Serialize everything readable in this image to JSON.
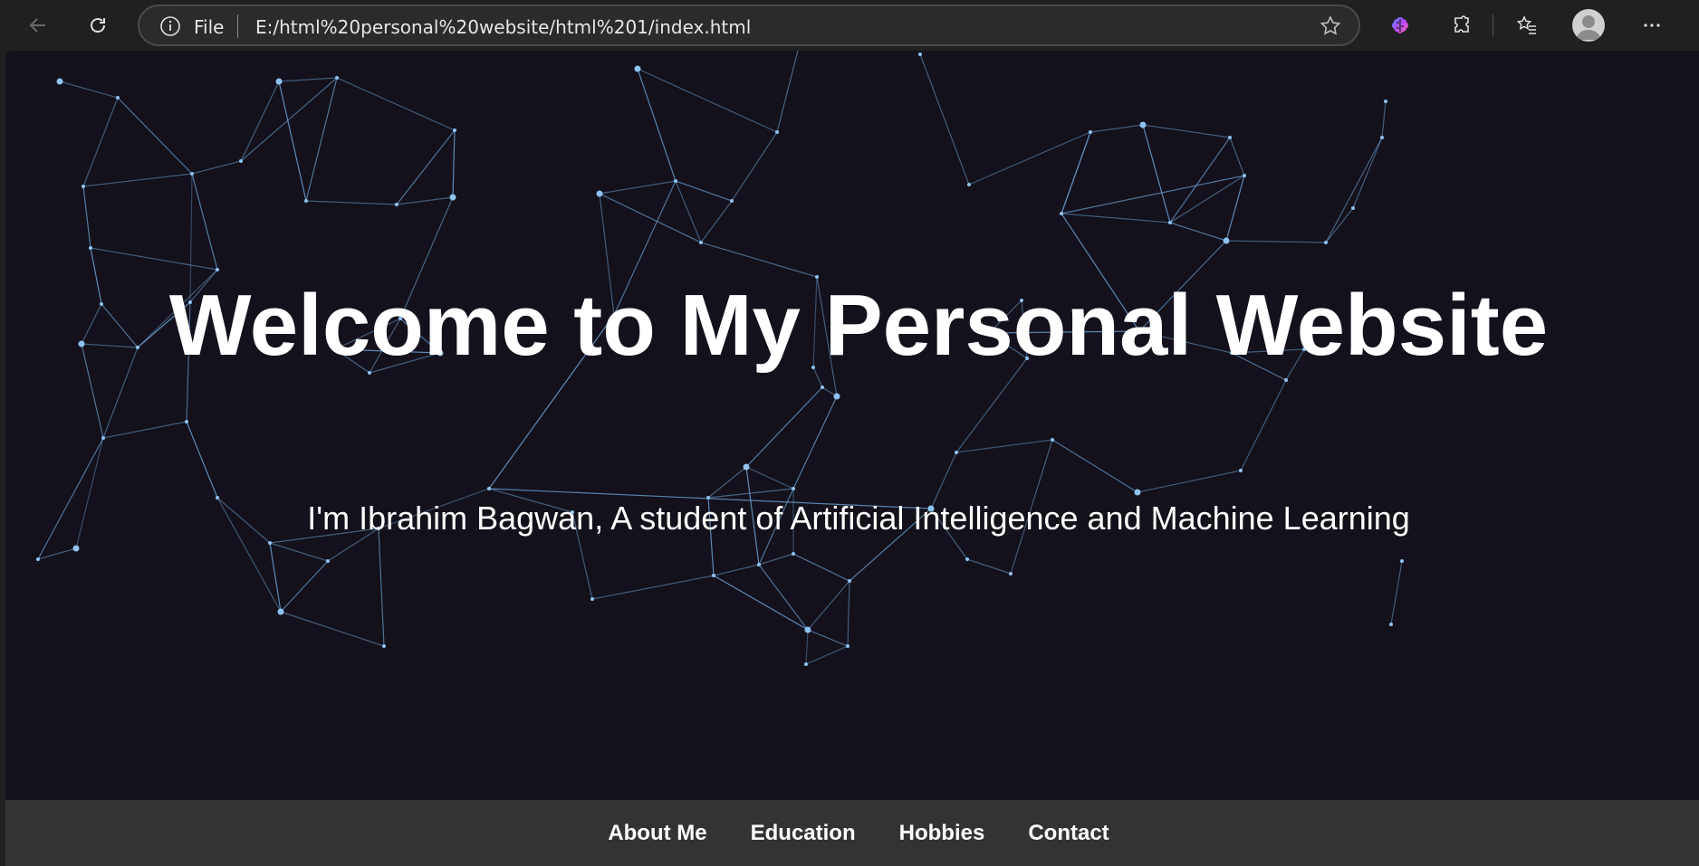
{
  "browser": {
    "address_scheme": "File",
    "address_url": "E:/html%20personal%20website/html%201/index.html"
  },
  "icons": [
    "back-arrow-icon",
    "refresh-icon",
    "info-icon",
    "star-icon",
    "brain-icon",
    "extensions-icon",
    "favorites-icon",
    "profile-icon",
    "more-icon"
  ],
  "hero": {
    "title": "Welcome to My Personal Website",
    "subtitle": "I'm Ibrahim Bagwan, A student of Artificial Intelligence and Machine Learning"
  },
  "nav": {
    "items": [
      "About Me",
      "Education",
      "Hobbies",
      "Contact"
    ]
  },
  "colors": {
    "page_bg": "#14111c",
    "network_line": "#6fa8dc",
    "navbar_bg": "#333333",
    "text": "#ffffff"
  }
}
